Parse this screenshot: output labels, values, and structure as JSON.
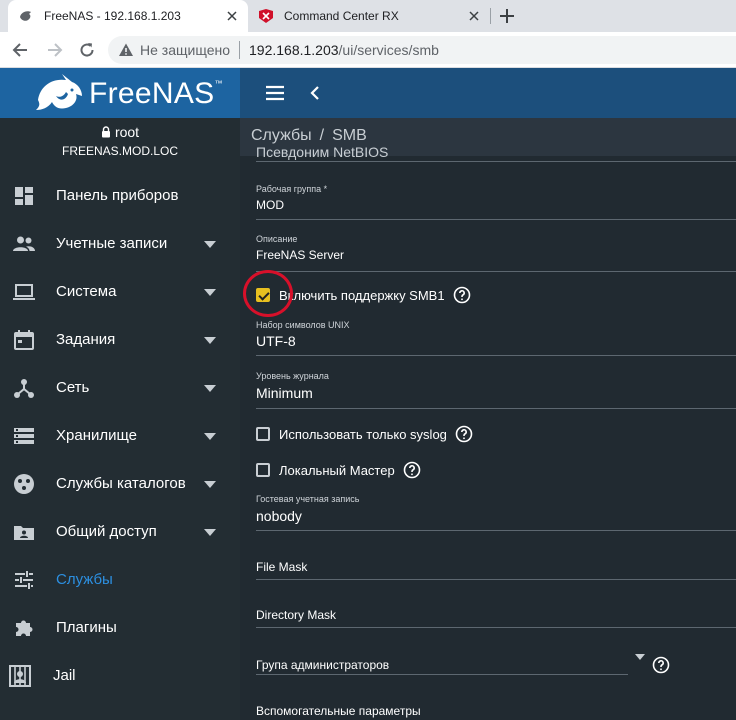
{
  "browser": {
    "tabs": [
      {
        "title": "FreeNAS - 192.168.1.203",
        "active": true,
        "icon": "freenas-favicon"
      },
      {
        "title": "Command Center RX",
        "active": false,
        "icon": "kyocera-favicon"
      }
    ],
    "address": {
      "security_label": "Не защищено",
      "host": "192.168.1.203",
      "path": "/ui/services/smb"
    }
  },
  "app": {
    "logo_text": "FreeNAS",
    "logo_mark": "™",
    "user": {
      "name": "root",
      "host": "FREENAS.MOD.LOC"
    },
    "nav": [
      {
        "label": "Панель приборов",
        "icon": "dashboard-icon",
        "expandable": false
      },
      {
        "label": "Учетные записи",
        "icon": "people-icon",
        "expandable": true
      },
      {
        "label": "Система",
        "icon": "laptop-icon",
        "expandable": true
      },
      {
        "label": "Задания",
        "icon": "calendar-icon",
        "expandable": true
      },
      {
        "label": "Сеть",
        "icon": "network-icon",
        "expandable": true
      },
      {
        "label": "Хранилище",
        "icon": "storage-icon",
        "expandable": true
      },
      {
        "label": "Службы каталогов",
        "icon": "directory-icon",
        "expandable": true
      },
      {
        "label": "Общий доступ",
        "icon": "share-icon",
        "expandable": true
      },
      {
        "label": "Службы",
        "icon": "tune-icon",
        "expandable": false,
        "active": true
      },
      {
        "label": "Плагины",
        "icon": "puzzle-icon",
        "expandable": false
      },
      {
        "label": "Jail",
        "icon": "jail-icon",
        "expandable": false
      }
    ],
    "breadcrumb": [
      "Службы",
      "SMB"
    ],
    "form": {
      "netbios_alias_label": "Псевдоним NetBIOS",
      "workgroup": {
        "label": "Рабочая группа *",
        "value": "MOD"
      },
      "description": {
        "label": "Описание",
        "value": "FreeNAS Server"
      },
      "enable_smb1": {
        "label": "Включить поддержку SMB1",
        "checked": true
      },
      "unix_charset": {
        "label": "Набор символов UNIX",
        "value": "UTF-8"
      },
      "log_level": {
        "label": "Уровень журнала",
        "value": "Minimum"
      },
      "syslog_only": {
        "label": "Использовать только syslog",
        "checked": false
      },
      "local_master": {
        "label": "Локальный Мастер",
        "checked": false
      },
      "guest_account": {
        "label": "Гостевая учетная запись",
        "value": "nobody"
      },
      "file_mask": {
        "placeholder": "File Mask"
      },
      "directory_mask": {
        "placeholder": "Directory Mask"
      },
      "admin_group": {
        "placeholder": "Група администраторов"
      },
      "aux_params": {
        "placeholder": "Вспомогательные параметры"
      }
    }
  },
  "colors": {
    "logo_bar": "#1d64a1",
    "top_bar": "#1c4f7c",
    "sidebar": "#232d33",
    "active_nav": "#2c8fe0",
    "checkbox_on": "#e8c020",
    "highlight_ring": "#d8102a"
  }
}
